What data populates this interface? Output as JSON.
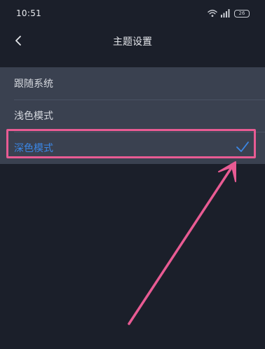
{
  "status_bar": {
    "time": "10:51",
    "battery": "26",
    "icons": [
      "wifi-icon",
      "signal-icon",
      "battery-icon"
    ]
  },
  "header": {
    "back_icon": "chevron-left-icon",
    "title": "主题设置"
  },
  "theme_options": [
    {
      "label": "跟随系统",
      "selected": false
    },
    {
      "label": "浅色模式",
      "selected": false
    },
    {
      "label": "深色模式",
      "selected": true
    }
  ],
  "colors": {
    "background": "#1b1f2a",
    "options_panel": "#3a4150",
    "selected_accent": "#3b87e6",
    "annotation": "#e85b93"
  }
}
